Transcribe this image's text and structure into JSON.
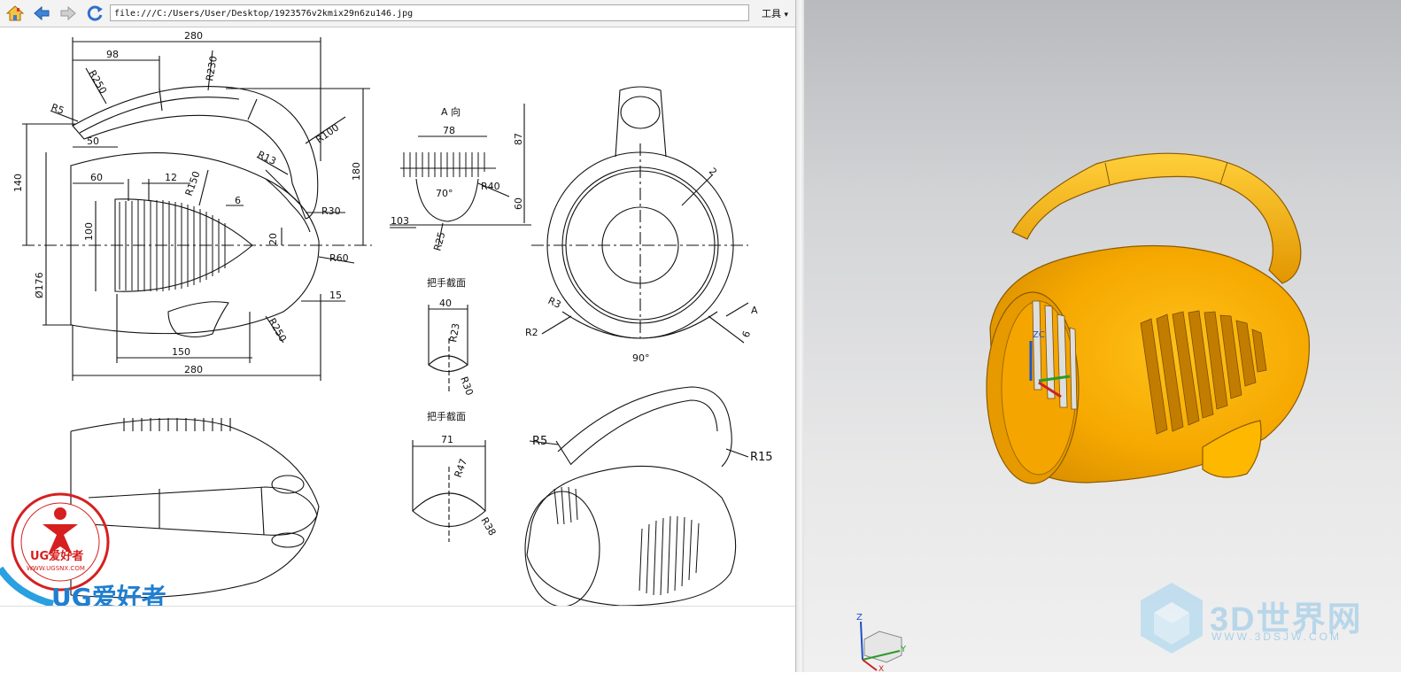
{
  "browser": {
    "url": "file:///C:/Users/User/Desktop/1923576v2kmix29n6zu146.jpg",
    "tools_label": "工具",
    "tools_arrow": "▾"
  },
  "drawing": {
    "dims": {
      "d280_top": "280",
      "d98": "98",
      "r230": "R230",
      "r250_top": "R250",
      "r5": "R5",
      "r100": "R100",
      "d50": "50",
      "d60": "60",
      "d12": "12",
      "r150": "R150",
      "d6": "6",
      "r13": "R13",
      "d140": "140",
      "d100": "100",
      "r30": "R30",
      "d20": "20",
      "d180": "180",
      "phi176": "Ø176",
      "r60": "R60",
      "d15": "15",
      "r250_bottom": "R250",
      "d150": "150",
      "d280_bottom": "280"
    },
    "view_a": {
      "title": "A 向",
      "d78": "78",
      "d87": "87",
      "d60": "60",
      "r40": "R40",
      "a70": "70°",
      "d103": "103",
      "r25": "R25"
    },
    "section1": {
      "title": "把手截面",
      "d40": "40",
      "r23": "R23",
      "r30": "R30"
    },
    "section2": {
      "title": "把手截面",
      "d71": "71",
      "r47": "R47",
      "r38": "R38"
    },
    "top_view": {
      "d2": "2",
      "r3": "R3",
      "r2": "R2",
      "a": "A",
      "d6": "6",
      "a90": "90°"
    },
    "iso": {
      "r5": "R5",
      "r15": "R15"
    },
    "logo": {
      "brand": "UG爱好者",
      "url": "WWW.UGSNX.COM",
      "banner": "UG爱好者"
    }
  },
  "viewer": {
    "zc_label": "ZC",
    "triad": {
      "z": "Z",
      "y": "Y",
      "x": "X"
    },
    "watermark": {
      "text": "3D世界网",
      "url": "WWW.3DSJW.COM"
    },
    "colors": {
      "model": "#f5a800",
      "model_dark": "#c98200",
      "model_light": "#ffd24a"
    }
  }
}
